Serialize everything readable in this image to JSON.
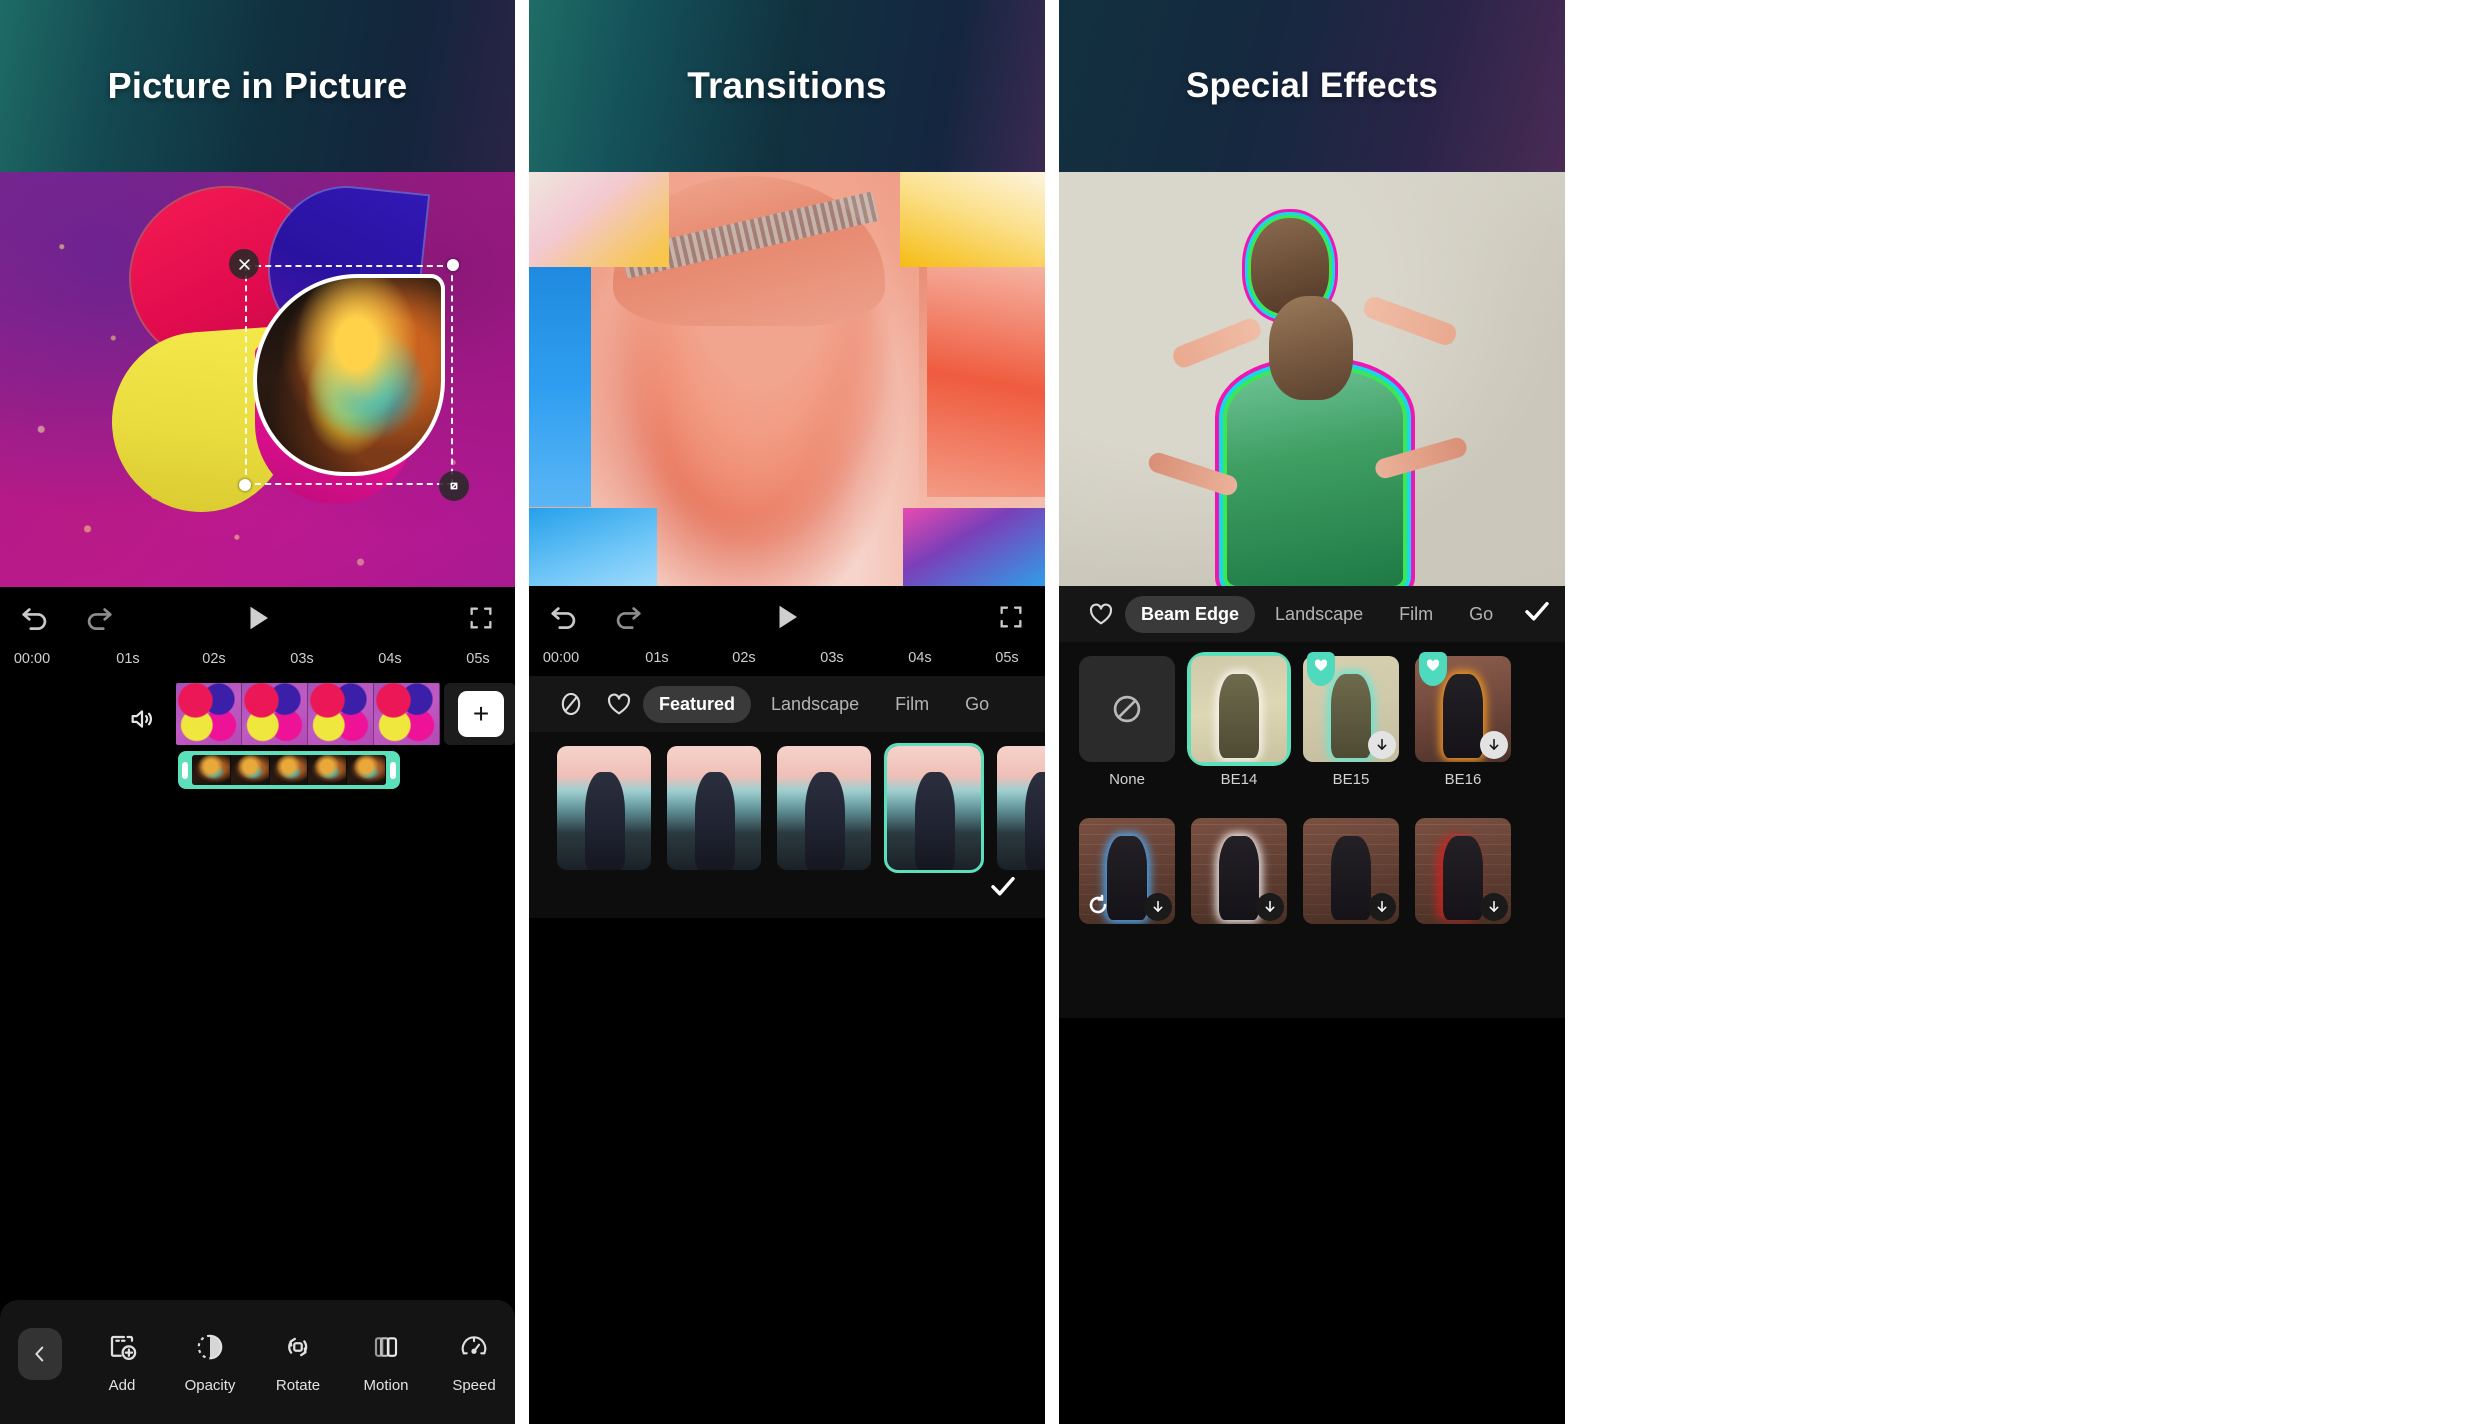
{
  "panels": [
    {
      "title": "Picture in Picture",
      "player": {
        "undo_icon": "undo-icon",
        "redo_icon": "redo-icon",
        "play_icon": "play-icon",
        "fullscreen_icon": "fullscreen-icon"
      },
      "ruler": [
        "00:00",
        "01s",
        "02s",
        "03s",
        "04s",
        "05s"
      ],
      "timeline": {
        "speaker_icon": "speaker-icon",
        "add_label": "+",
        "clip_frames": 4,
        "pip_frames": 5
      },
      "toolbar": {
        "back_icon": "chevron-left-icon",
        "tools": [
          {
            "label": "Add",
            "icon": "add-frame-icon"
          },
          {
            "label": "Opacity",
            "icon": "opacity-icon"
          },
          {
            "label": "Rotate",
            "icon": "rotate-icon"
          },
          {
            "label": "Motion",
            "icon": "motion-icon"
          },
          {
            "label": "Speed",
            "icon": "speed-icon"
          }
        ]
      },
      "overlay": {
        "close_icon": "close-icon",
        "resize_icon": "resize-handle-icon"
      }
    },
    {
      "title": "Transitions",
      "player": {
        "undo_icon": "undo-icon",
        "redo_icon": "redo-icon",
        "play_icon": "play-icon",
        "fullscreen_icon": "fullscreen-icon"
      },
      "ruler": [
        "00:00",
        "01s",
        "02s",
        "03s",
        "04s",
        "05s"
      ],
      "tabs": {
        "none_icon": "no-transition-icon",
        "favorite_icon": "heart-icon",
        "items": [
          {
            "label": "Featured",
            "active": true
          },
          {
            "label": "Landscape",
            "active": false
          },
          {
            "label": "Film",
            "active": false
          },
          {
            "label": "Go",
            "active": false
          }
        ]
      },
      "thumbnails": [
        {
          "selected": false
        },
        {
          "selected": false
        },
        {
          "selected": false
        },
        {
          "selected": true
        },
        {
          "selected": false
        }
      ],
      "confirm_icon": "checkmark-icon"
    },
    {
      "title": "Special Effects",
      "tabs": {
        "favorite_icon": "heart-icon",
        "items": [
          {
            "label": "Beam Edge",
            "active": true
          },
          {
            "label": "Landscape",
            "active": false
          },
          {
            "label": "Film",
            "active": false
          },
          {
            "label": "Go",
            "active": false
          }
        ],
        "confirm_icon": "checkmark-icon"
      },
      "effects_row1": [
        {
          "label": "None",
          "style": "none",
          "selected": false,
          "favorite": false,
          "download": false
        },
        {
          "label": "BE14",
          "style": "be14",
          "selected": true,
          "favorite": false,
          "download": false
        },
        {
          "label": "BE15",
          "style": "be15",
          "selected": false,
          "favorite": true,
          "download": true
        },
        {
          "label": "BE16",
          "style": "be16",
          "selected": false,
          "favorite": true,
          "download": true
        }
      ],
      "effects_row2": [
        {
          "label": "",
          "style": "blue",
          "selected": false,
          "favorite": false,
          "download": true,
          "reload": true
        },
        {
          "label": "",
          "style": "white",
          "selected": false,
          "favorite": false,
          "download": true,
          "reload": false
        },
        {
          "label": "",
          "style": "plain",
          "selected": false,
          "favorite": false,
          "download": true,
          "reload": false
        },
        {
          "label": "",
          "style": "red",
          "selected": false,
          "favorite": false,
          "download": true,
          "reload": false
        }
      ]
    }
  ],
  "colors": {
    "accent_teal": "#5ce0bc",
    "header_teal": "#1e6b66",
    "header_navy": "#10303f",
    "header_purple": "#4a2b55",
    "panel_bg": "#000000",
    "toolbar_bg": "#141414"
  }
}
